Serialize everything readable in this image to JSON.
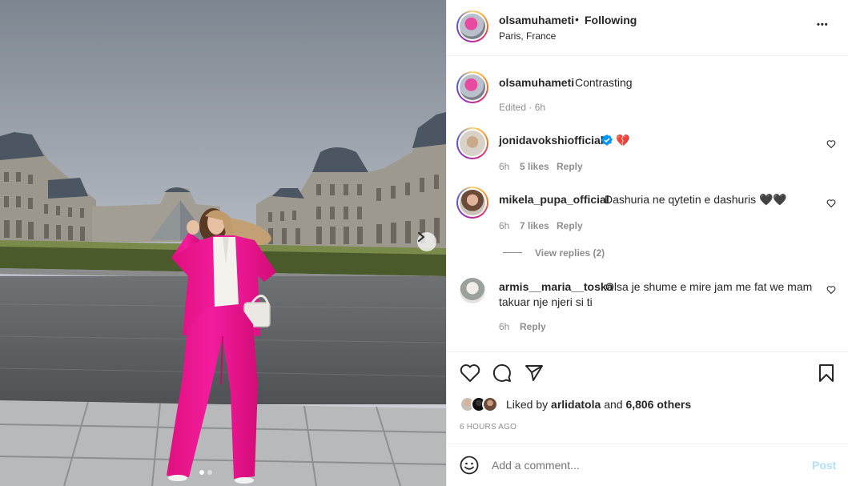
{
  "post": {
    "username": "olsamuhameti",
    "follow_status": "Following",
    "separator": "•",
    "location": "Paris, France",
    "more_label": "•••"
  },
  "caption": {
    "username": "olsamuhameti",
    "text": "Contrasting",
    "meta": "Edited · 6h"
  },
  "comments": [
    {
      "username": "jonidavokshiofficial",
      "verified": true,
      "text": "💔",
      "time": "6h",
      "likes": "5 likes",
      "reply": "Reply"
    },
    {
      "username": "mikela_pupa_official",
      "verified": false,
      "text": "Dashuria ne qytetin e dashuris 🖤🖤",
      "time": "6h",
      "likes": "7 likes",
      "reply": "Reply",
      "view_replies": "View replies (2)"
    },
    {
      "username": "armis__maria__toska",
      "verified": false,
      "text_line1": "Olsa je shume e mire jam me fat we mam",
      "text_line2": "takuar nje njeri si ti",
      "time": "6h",
      "reply": "Reply"
    }
  ],
  "likes": {
    "prefix": "Liked by",
    "user": "arlidatola",
    "middle": "and",
    "count": "6,806 others"
  },
  "timestamp": "6 HOURS AGO",
  "add_comment": {
    "placeholder": "Add a comment...",
    "post_label": "Post"
  },
  "carousel": {
    "current": 1,
    "total": 2
  },
  "colors": {
    "accent": "#0095f6",
    "post_disabled": "#b2dffc",
    "verified": "#0095f6",
    "suit": "#f0199a"
  }
}
